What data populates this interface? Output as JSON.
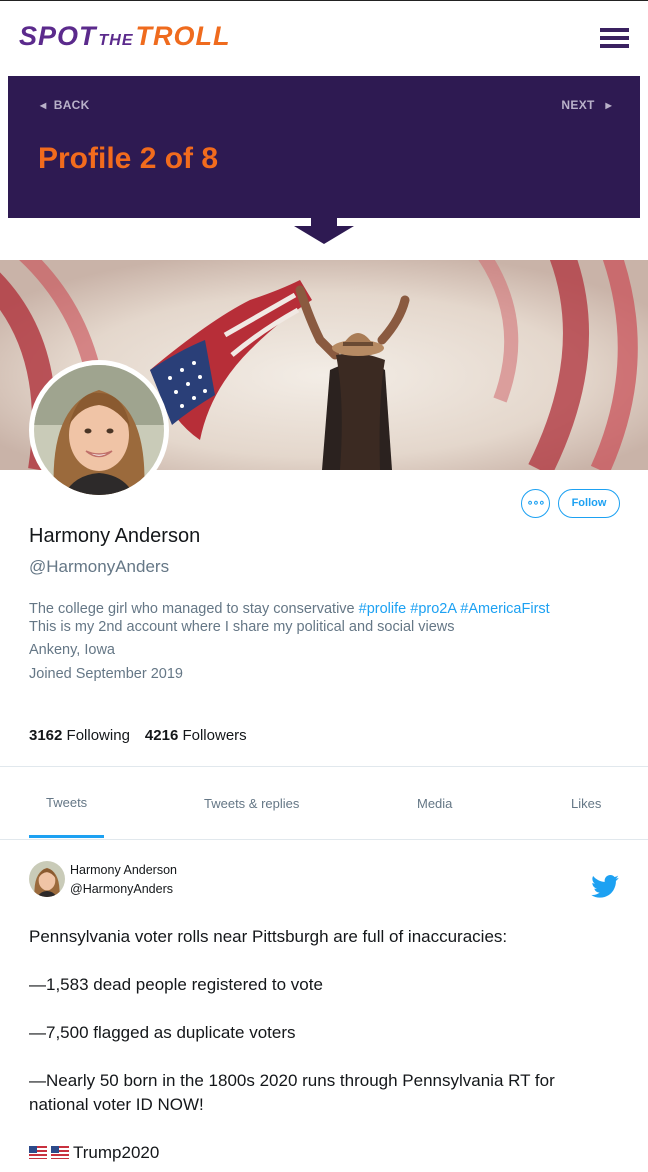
{
  "logo": {
    "part1": "SPOT",
    "part2": "THE",
    "part3": "TROLL"
  },
  "banner": {
    "back_label": "BACK",
    "next_label": "NEXT",
    "title": "Profile 2 of 8"
  },
  "profile": {
    "name": "Harmony Anderson",
    "handle": "@HarmonyAnders",
    "bio_text": "The college girl who managed to stay conservative ",
    "bio_tags": [
      "#prolife",
      "#pro2A",
      "#AmericaFirst"
    ],
    "bio_line2": "This is my 2nd account where I share my political and social views",
    "location": "Ankeny, Iowa",
    "joined": "Joined September 2019",
    "following_count": "3162",
    "following_label": "Following",
    "followers_count": "4216",
    "followers_label": "Followers",
    "more_label": "∘∘∘",
    "follow_label": "Follow"
  },
  "tabs": [
    {
      "label": "Tweets",
      "active": true
    },
    {
      "label": "Tweets & replies",
      "active": false
    },
    {
      "label": "Media",
      "active": false
    },
    {
      "label": "Likes",
      "active": false
    }
  ],
  "tweet": {
    "author_name": "Harmony Anderson",
    "author_handle": "@HarmonyAnders",
    "paragraphs": [
      "Pennsylvania voter rolls near Pittsburgh are full of inaccuracies:",
      "—1,583 dead people registered to vote",
      "—7,500 flagged as duplicate voters",
      "—Nearly 50 born in the 1800s 2020 runs through Pennsylvania RT for national voter ID NOW!"
    ],
    "closing_text": "Trump2020"
  },
  "colors": {
    "brand_purple": "#5b2a8c",
    "banner_bg": "#2e1a52",
    "accent_orange": "#f26b1d",
    "twitter_blue": "#1da1f2"
  },
  "icons": [
    "menu-icon",
    "chevron-left-icon",
    "chevron-right-icon",
    "more-icon",
    "twitter-bird-icon",
    "us-flag-icon"
  ]
}
